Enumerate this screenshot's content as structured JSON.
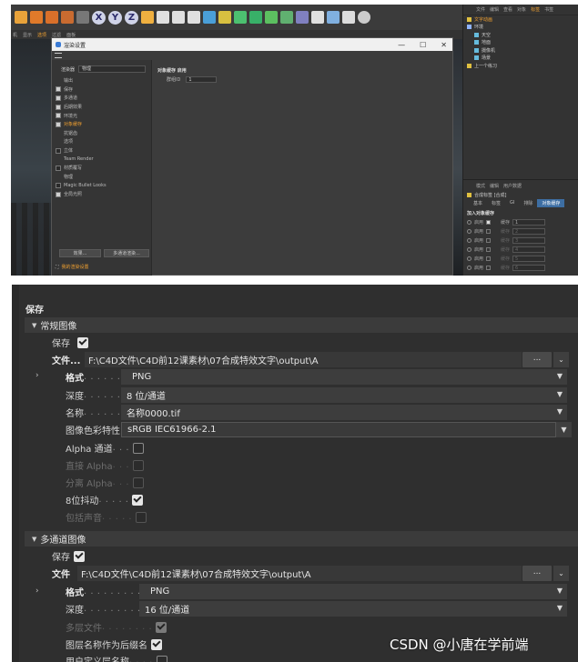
{
  "top": {
    "menubar": [
      "机",
      "显示",
      "选项",
      "过滤",
      "面板"
    ],
    "dialog": {
      "title": "渲染设置",
      "controls": [
        "—",
        "☐",
        "✕"
      ],
      "renderer_label": "渲染器",
      "renderer_value": "物理",
      "tree": [
        {
          "label": "输出",
          "checkbox": null
        },
        {
          "label": "保存",
          "checkbox": true
        },
        {
          "label": "多通道",
          "checkbox": true
        },
        {
          "label": "后期效果",
          "checkbox": true
        },
        {
          "label": "环境光",
          "checkbox": true
        },
        {
          "label": "对象缓存",
          "checkbox": true,
          "active": true
        },
        {
          "label": "抗锯齿",
          "checkbox": null
        },
        {
          "label": "选项",
          "checkbox": null
        },
        {
          "label": "立体",
          "checkbox": false
        },
        {
          "label": "Team Render",
          "checkbox": null
        },
        {
          "label": "材质覆写",
          "checkbox": false
        },
        {
          "label": "物理",
          "checkbox": null
        },
        {
          "label": "Magic Bullet Looks",
          "checkbox": false
        },
        {
          "label": "全局光照",
          "checkbox": true
        }
      ],
      "effect_button": "效果...",
      "multipass_button": "多通道渲染...",
      "my_settings": "我的渲染设置",
      "section_title": "对象缓存 启用",
      "group_id_label": "群组ID",
      "group_id_value": "1"
    },
    "objects": {
      "menu": [
        "文件",
        "编辑",
        "查看",
        "对象",
        "标签",
        "书签"
      ],
      "menu_highlight": "标签",
      "rows": [
        {
          "label": "文字动画",
          "selected": true
        },
        {
          "label": "环境",
          "selected": false
        },
        {
          "label": "天空",
          "selected": false
        },
        {
          "label": "地面",
          "selected": false
        },
        {
          "label": "摄像机",
          "selected": false
        },
        {
          "label": "场景",
          "selected": false
        },
        {
          "label": "上一个练习",
          "selected": false
        }
      ],
      "attr_menu": [
        "模式",
        "编辑",
        "用户数据"
      ],
      "attr_title": "合成标签 [合成]",
      "attr_tabs": [
        "基本",
        "标签",
        "GI",
        "排除",
        "对象缓存"
      ],
      "attr_tab_active": "对象缓存",
      "add_label": "加入对象缓存",
      "layers": [
        {
          "enable": "启用",
          "on": true,
          "buffer": "缓存",
          "value": "1"
        },
        {
          "enable": "启用",
          "on": false,
          "buffer": "缓存",
          "value": "2"
        },
        {
          "enable": "启用",
          "on": false,
          "buffer": "缓存",
          "value": "3"
        },
        {
          "enable": "启用",
          "on": false,
          "buffer": "缓存",
          "value": "4"
        },
        {
          "enable": "启用",
          "on": false,
          "buffer": "缓存",
          "value": "5"
        },
        {
          "enable": "启用",
          "on": false,
          "buffer": "缓存",
          "value": "6"
        }
      ]
    }
  },
  "save_panel": {
    "title": "保存",
    "regular": {
      "header": "常规图像",
      "save_label": "保存",
      "save_checked": true,
      "file_label": "文件...",
      "file_path": "F:\\C4D文件\\C4D前12课素材\\07合成特效文字\\output\\A",
      "browse_button": "...",
      "format_label": "格式",
      "format_value": "PNG",
      "depth_label": "深度",
      "depth_value": "8 位/通道",
      "name_label": "名称",
      "name_value": "名称0000.tif",
      "color_profile_label": "图像色彩特性",
      "color_profile_value": "sRGB IEC61966-2.1",
      "alpha_label": "Alpha 通道",
      "alpha_checked": false,
      "straight_alpha_label": "直接 Alpha",
      "separate_alpha_label": "分离 Alpha",
      "dither_label": "8位抖动",
      "dither_checked": true,
      "include_sound_label": "包括声音"
    },
    "multipass": {
      "header": "多通道图像",
      "save_label": "保存",
      "save_checked": true,
      "file_label": "文件",
      "file_path": "F:\\C4D文件\\C4D前12课素材\\07合成特效文字\\output\\A",
      "browse_button": "...",
      "format_label": "格式",
      "format_value": "PNG",
      "depth_label": "深度",
      "depth_value": "16 位/通道",
      "multilayer_label": "多层文件",
      "layer_names_label": "图层名称作为后缀名",
      "layer_names_checked": true,
      "user_names_label": "用户定义层名称"
    }
  },
  "watermark": "CSDN @小唐在学前端",
  "colors": {
    "accent": "#f0a030",
    "tab_active": "#3d6ea3",
    "panel_bg": "#2f2f2f",
    "header_bg": "#3b3b3b"
  }
}
